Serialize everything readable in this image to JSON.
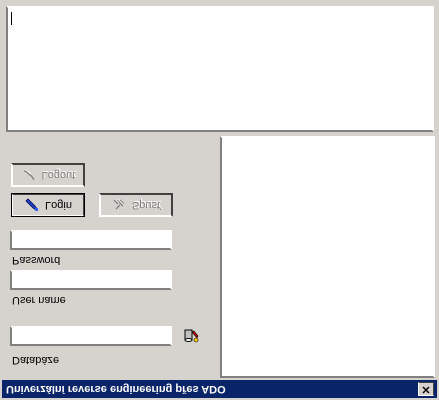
{
  "window": {
    "title": "Univerzální reverse engineering přes ADO",
    "close_glyph": "✕"
  },
  "form": {
    "database_label": "Databáze",
    "database_value": "",
    "user_label": "User name",
    "user_value": "",
    "password_label": "Password",
    "password_value": ""
  },
  "buttons": {
    "login": {
      "label": "Login",
      "enabled": true,
      "focused": true
    },
    "spust": {
      "label": "Spusť",
      "enabled": false
    },
    "logout": {
      "label": "Logout",
      "enabled": false
    }
  },
  "icons": {
    "database_picker": "database-connect-icon",
    "login": "key-icon",
    "spust": "run-icon",
    "logout": "logout-icon"
  },
  "colors": {
    "title_bar": "#0a246a",
    "window_face": "#d6d3ce",
    "disabled_text": "#808080"
  }
}
